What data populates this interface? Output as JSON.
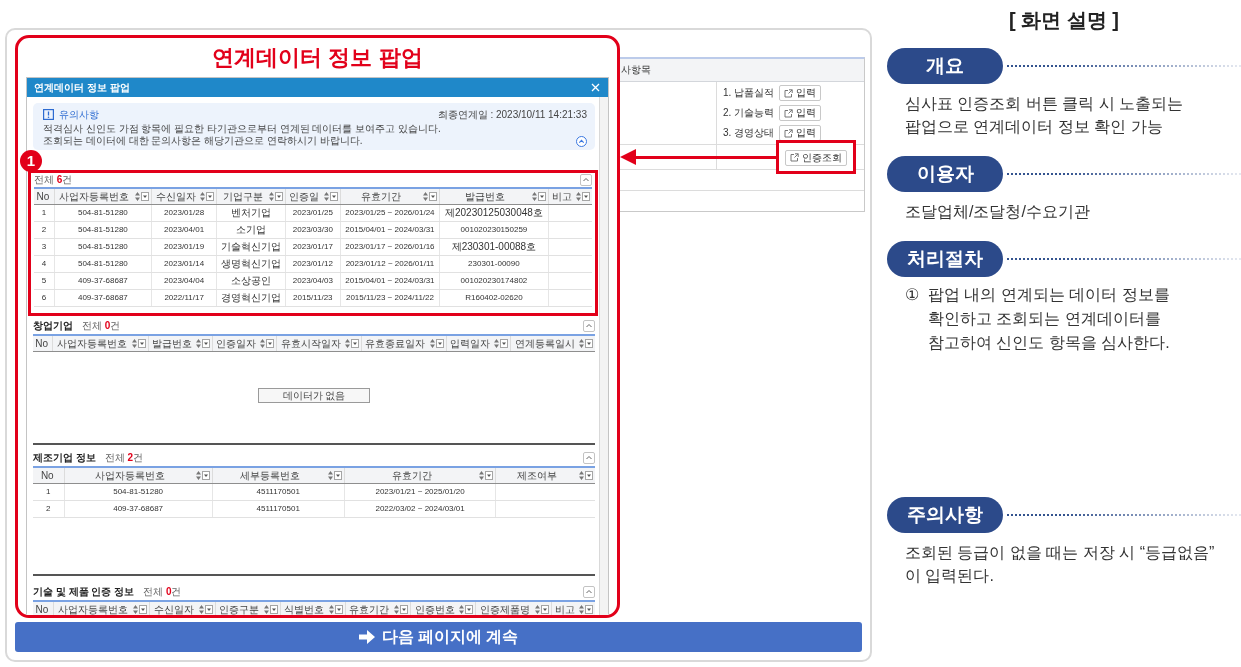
{
  "popup": {
    "caption": "연계데이터 정보 팝업",
    "title": "연계데이터 정보 팝업",
    "notice": {
      "title": "유의사항",
      "timestamp": "최종연계일 : 2023/10/11 14:21:33",
      "lines": [
        "적격심사 신인도 가점 항목에 필요한 타기관으로부터 연계된 데이터를 보여주고 있습니다.",
        "조회되는 데이터에 대한 문의사항은 해당기관으로 연락하시기 바랍니다."
      ]
    },
    "sections": [
      {
        "count": "전체 **6**건",
        "highlighted": true,
        "marker": "1",
        "columns": [
          {
            "label": "No",
            "sortable": false
          },
          {
            "label": "사업자등록번호",
            "sortable": true
          },
          {
            "label": "수신일자",
            "sortable": true
          },
          {
            "label": "기업구분",
            "sortable": true
          },
          {
            "label": "인증일",
            "sortable": true
          },
          {
            "label": "유효기간",
            "sortable": true
          },
          {
            "label": "발급번호",
            "sortable": true
          },
          {
            "label": "비고",
            "sortable": true
          }
        ],
        "rows": [
          [
            "1",
            "504-81-51280",
            "2023/01/28",
            "벤처기업",
            "2023/01/25",
            "2023/01/25 ~ 2026/01/24",
            "제20230125030048호"
          ],
          [
            "2",
            "504-81-51280",
            "2023/04/01",
            "소기업",
            "2023/03/30",
            "2015/04/01 ~ 2024/03/31",
            "001020230150259"
          ],
          [
            "3",
            "504-81-51280",
            "2023/01/19",
            "기술혁신기업",
            "2023/01/17",
            "2023/01/17 ~ 2026/01/16",
            "제230301-00088호"
          ],
          [
            "4",
            "504-81-51280",
            "2023/01/14",
            "생명혁신기업",
            "2023/01/12",
            "2023/01/12 ~ 2026/01/11",
            "230301-00090"
          ],
          [
            "5",
            "409-37-68687",
            "2023/04/04",
            "소상공인",
            "2023/04/03",
            "2015/04/01 ~ 2024/03/31",
            "001020230174802"
          ],
          [
            "6",
            "409-37-68687",
            "2022/11/17",
            "경영혁신기업",
            "2015/11/23",
            "2015/11/23 ~ 2024/11/22",
            "R160402-02620"
          ]
        ]
      },
      {
        "title": "창업기업",
        "count": "전체 **0**건",
        "highlighted": false,
        "columns": [
          {
            "label": "No",
            "sortable": false
          },
          {
            "label": "사업자등록번호",
            "sortable": true
          },
          {
            "label": "발급번호",
            "sortable": true
          },
          {
            "label": "인증일자",
            "sortable": true
          },
          {
            "label": "유효시작일자",
            "sortable": true
          },
          {
            "label": "유효종료일자",
            "sortable": true
          },
          {
            "label": "입력일자",
            "sortable": true
          },
          {
            "label": "연계등록일시",
            "sortable": true
          }
        ],
        "empty_text": "데이터가 없음"
      },
      {
        "title": "제조기업 정보",
        "count": "전체 **2**건",
        "highlighted": false,
        "columns": [
          {
            "label": "No",
            "sortable": false
          },
          {
            "label": "사업자등록번호",
            "sortable": true
          },
          {
            "label": "세부등록번호",
            "sortable": true
          },
          {
            "label": "유효기간",
            "sortable": true
          },
          {
            "label": "제조여부",
            "sortable": true
          }
        ],
        "rows": [
          [
            "1",
            "504-81-51280",
            "4511170501",
            "2023/01/21 ~ 2025/01/20"
          ],
          [
            "2",
            "409-37-68687",
            "4511170501",
            "2022/03/02 ~ 2024/03/01"
          ]
        ]
      },
      {
        "title": "기술 및 제품 인증 정보",
        "count": "전체 **0**건",
        "highlighted": false,
        "columns": [
          {
            "label": "No",
            "sortable": false
          },
          {
            "label": "사업자등록번호",
            "sortable": true
          },
          {
            "label": "수신일자",
            "sortable": true
          },
          {
            "label": "인증구분",
            "sortable": true
          },
          {
            "label": "식별번호",
            "sortable": true
          },
          {
            "label": "유효기간",
            "sortable": true
          },
          {
            "label": "인증번호",
            "sortable": true
          },
          {
            "label": "인증제품명",
            "sortable": true
          },
          {
            "label": "비고",
            "sortable": true
          }
        ]
      }
    ]
  },
  "background_screen": {
    "header": "사항목",
    "groups": [
      {
        "rows": [
          {
            "label": "1. 납품실적",
            "button": "입력",
            "highlighted": false
          },
          {
            "label": "2. 기술능력",
            "button": "입력",
            "highlighted": false
          },
          {
            "label": "3. 경영상태",
            "button": "입력",
            "highlighted": false
          }
        ]
      },
      {
        "rows": [
          {
            "button": "인증조회",
            "highlighted": true
          }
        ]
      }
    ]
  },
  "continue_banner": "다음 페이지에 계속",
  "description": {
    "heading": "[ 화면 설명 ]",
    "sections": [
      {
        "label": "개요",
        "kind": "text",
        "text": "심사표 인증조회 버튼 클릭 시 노출되는\n팝업으로 연계데이터 정보 확인 가능"
      },
      {
        "label": "이용자",
        "kind": "text",
        "text": "조달업체/조달청/수요기관"
      },
      {
        "label": "처리절차",
        "kind": "steps",
        "steps": [
          {
            "number": "①",
            "text": "팝업 내의 연계되는 데이터 정보를\n확인하고 조회되는 연계데이터를\n참고하여 신인도 항목을 심사한다."
          }
        ]
      },
      {
        "label": "주의사항",
        "kind": "text",
        "text": "조회된 등급이 없을 때는 저장 시 “등급없음”\n이 입력된다."
      }
    ]
  }
}
